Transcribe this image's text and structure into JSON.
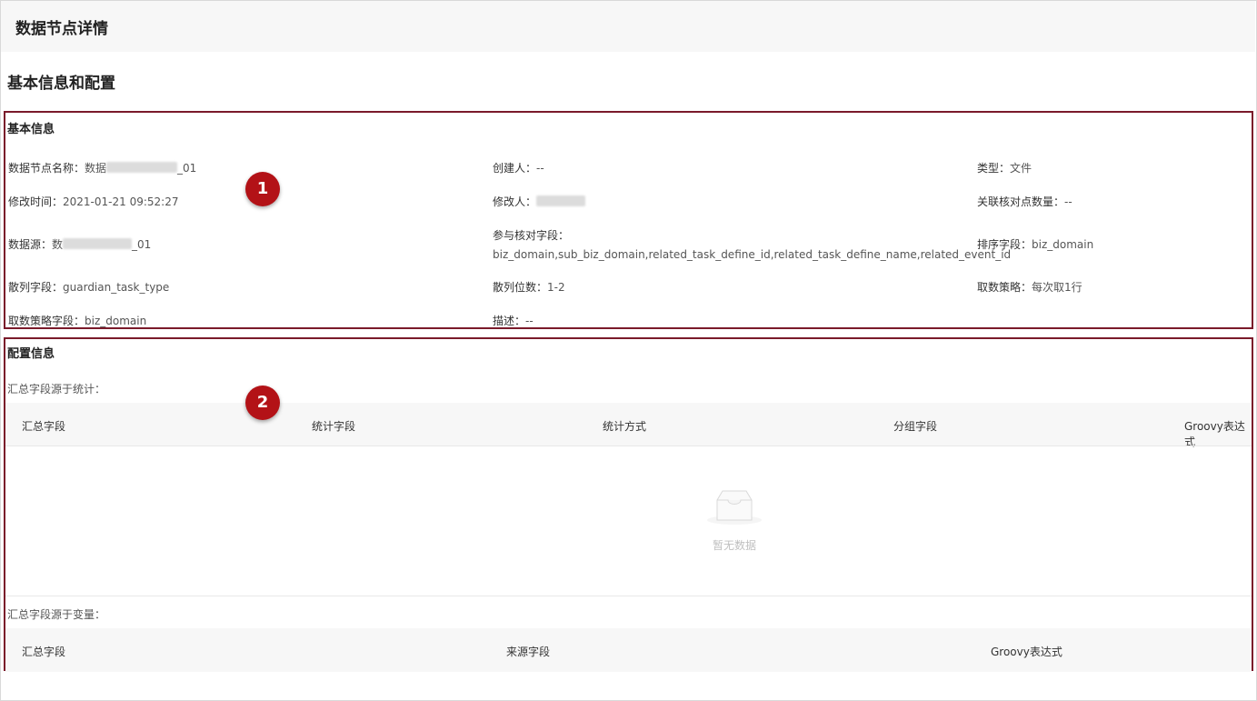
{
  "page": {
    "title": "数据节点详情",
    "section_title": "基本信息和配置"
  },
  "basic": {
    "title": "基本信息",
    "badge": "1",
    "fields": {
      "node_name": {
        "label": "数据节点名称：",
        "value_prefix": "数据",
        "value_suffix": "_01"
      },
      "creator": {
        "label": "创建人：",
        "value": "--"
      },
      "type": {
        "label": "类型：",
        "value": "文件"
      },
      "modified_time": {
        "label": "修改时间：",
        "value": "2021-01-21 09:52:27"
      },
      "modifier": {
        "label": "修改人："
      },
      "related_count": {
        "label": "关联核对点数量：",
        "value": "--"
      },
      "datasource": {
        "label": "数据源：",
        "value_prefix": "数",
        "value_suffix": "_01"
      },
      "check_fields": {
        "label": "参与核对字段：",
        "value": "biz_domain,sub_biz_domain,related_task_define_id,related_task_define_name,related_event_id"
      },
      "sort_field": {
        "label": "排序字段：",
        "value": "biz_domain"
      },
      "hash_field": {
        "label": "散列字段：",
        "value": "guardian_task_type"
      },
      "hash_digits": {
        "label": "散列位数：",
        "value": "1-2"
      },
      "fetch_strategy": {
        "label": "取数策略：",
        "value": "每次取1行"
      },
      "fetch_strategy_field": {
        "label": "取数策略字段：",
        "value": "biz_domain"
      },
      "description": {
        "label": "描述：",
        "value": "--"
      }
    }
  },
  "config": {
    "title": "配置信息",
    "badge": "2",
    "stats_label": "汇总字段源于统计：",
    "stats_columns": [
      "汇总字段",
      "统计字段",
      "统计方式",
      "分组字段",
      "Groovy表达式"
    ],
    "empty_text": "暂无数据",
    "vars_label": "汇总字段源于变量：",
    "vars_columns": [
      "汇总字段",
      "来源字段",
      "Groovy表达式"
    ]
  },
  "colors": {
    "highlight_border": "#7a1a2a",
    "badge_bg": "#b31217",
    "header_bg": "#f7f7f7"
  },
  "icons": [
    "empty-inbox-icon"
  ]
}
